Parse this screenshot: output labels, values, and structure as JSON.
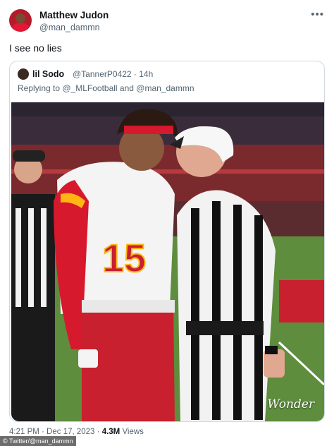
{
  "tweet": {
    "author_name": "Matthew Judon",
    "author_handle": "@man_dammn",
    "more_icon": "ellipsis-icon",
    "text": "I see no lies",
    "quoted": {
      "author_name": "lil Sodo",
      "author_handle": "@TannerP0422",
      "time": "· 14h",
      "replying_to": "Replying to @_MLFootball and @man_dammn",
      "image": {
        "watermark": "Wonder",
        "player_number": "15"
      }
    },
    "timestamp": "4:21 PM · Dec 17, 2023 · ",
    "views_count": "4.3M",
    "views_label": " Views"
  },
  "credit": "© Twitter/@man_dammn",
  "colors": {
    "chiefs_red": "#e31837",
    "chiefs_gold": "#ffb612",
    "handle_gray": "#536471",
    "border": "#cfd9de"
  }
}
